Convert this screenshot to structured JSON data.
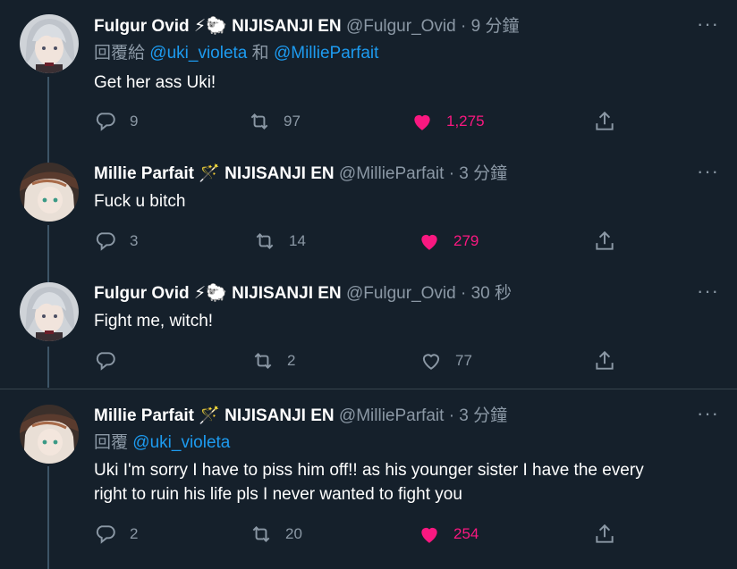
{
  "tweets": [
    {
      "name": "Fulgur Ovid",
      "emoji": "⚡🐑",
      "org": "NIJISANJI EN",
      "handle": "@Fulgur_Ovid",
      "time": "9 分鐘",
      "reply_prefix": "回覆給",
      "reply_mention_1": "@uki_violeta",
      "reply_joiner": "和",
      "reply_mention_2": "@MillieParfait",
      "text": "Get her ass Uki!",
      "replies": "9",
      "retweets": "97",
      "likes": "1,275",
      "liked": true
    },
    {
      "name": "Millie Parfait",
      "emoji": "🪄",
      "org": "NIJISANJI EN",
      "handle": "@MillieParfait",
      "time": "3 分鐘",
      "text": "Fuck u bitch",
      "replies": "3",
      "retweets": "14",
      "likes": "279",
      "liked": true
    },
    {
      "name": "Fulgur Ovid",
      "emoji": "⚡🐑",
      "org": "NIJISANJI EN",
      "handle": "@Fulgur_Ovid",
      "time": "30 秒",
      "text": "Fight me, witch!",
      "replies": "",
      "retweets": "2",
      "likes": "77",
      "liked": false
    },
    {
      "name": "Millie Parfait",
      "emoji": "🪄",
      "org": "NIJISANJI EN",
      "handle": "@MillieParfait",
      "time": "3 分鐘",
      "reply_prefix": "回覆",
      "reply_mention_1": "@uki_violeta",
      "text_line_1": "Uki I'm sorry I have to piss him off!! as his younger sister I have the every",
      "text_line_2": "right to ruin his life pls I never wanted to fight you",
      "replies": "2",
      "retweets": "20",
      "likes": "254",
      "liked": true
    }
  ],
  "separator_dot": "·",
  "more_glyph": "···",
  "colors": {
    "background": "#15202b",
    "secondary_text": "#8b98a5",
    "link": "#1d9bf0",
    "like": "#f91880",
    "thread_line": "#3d5466"
  }
}
